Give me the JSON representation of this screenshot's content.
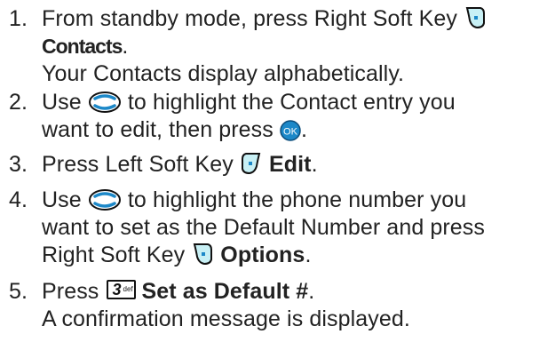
{
  "steps": [
    {
      "number": "1.",
      "lines": {
        "l1_text": "From standby mode, press Right Soft Key",
        "l2_bold": "Contacts",
        "l2_after": ".",
        "l3_text": "Your Contacts display alphabetically."
      },
      "icons": [
        "right-soft-key-icon"
      ]
    },
    {
      "number": "2.",
      "lines": {
        "l1_before": "Use",
        "l1_after": "to highlight the Contact entry you",
        "l2_before": "want to edit, then press",
        "l2_after": "."
      },
      "icons": [
        "navigation-key-icon",
        "ok-key-icon"
      ]
    },
    {
      "number": "3.",
      "lines": {
        "l1_before": "Press Left Soft Key",
        "l1_bold": "Edit",
        "l1_after": "."
      },
      "icons": [
        "left-soft-key-icon"
      ]
    },
    {
      "number": "4.",
      "lines": {
        "l1_before": "Use",
        "l1_after": "to highlight the phone number you",
        "l2_text": "want to set as the Default Number and press",
        "l3_before": "Right Soft Key",
        "l3_bold": "Options",
        "l3_after": "."
      },
      "icons": [
        "navigation-key-icon",
        "right-soft-key-icon"
      ]
    },
    {
      "number": "5.",
      "lines": {
        "l1_before": "Press",
        "l1_bold": "Set as Default #",
        "l1_after": ".",
        "l2_text": "A confirmation message is displayed."
      },
      "key_label": {
        "digit": "3",
        "letters": "def"
      },
      "icons": [
        "key-3-icon"
      ]
    }
  ],
  "colors": {
    "text": "#222222",
    "ok_key_fill": "#1c88c8",
    "nav_key_fill": "#1c88c8",
    "soft_key_fill": "#c8f0f5"
  }
}
